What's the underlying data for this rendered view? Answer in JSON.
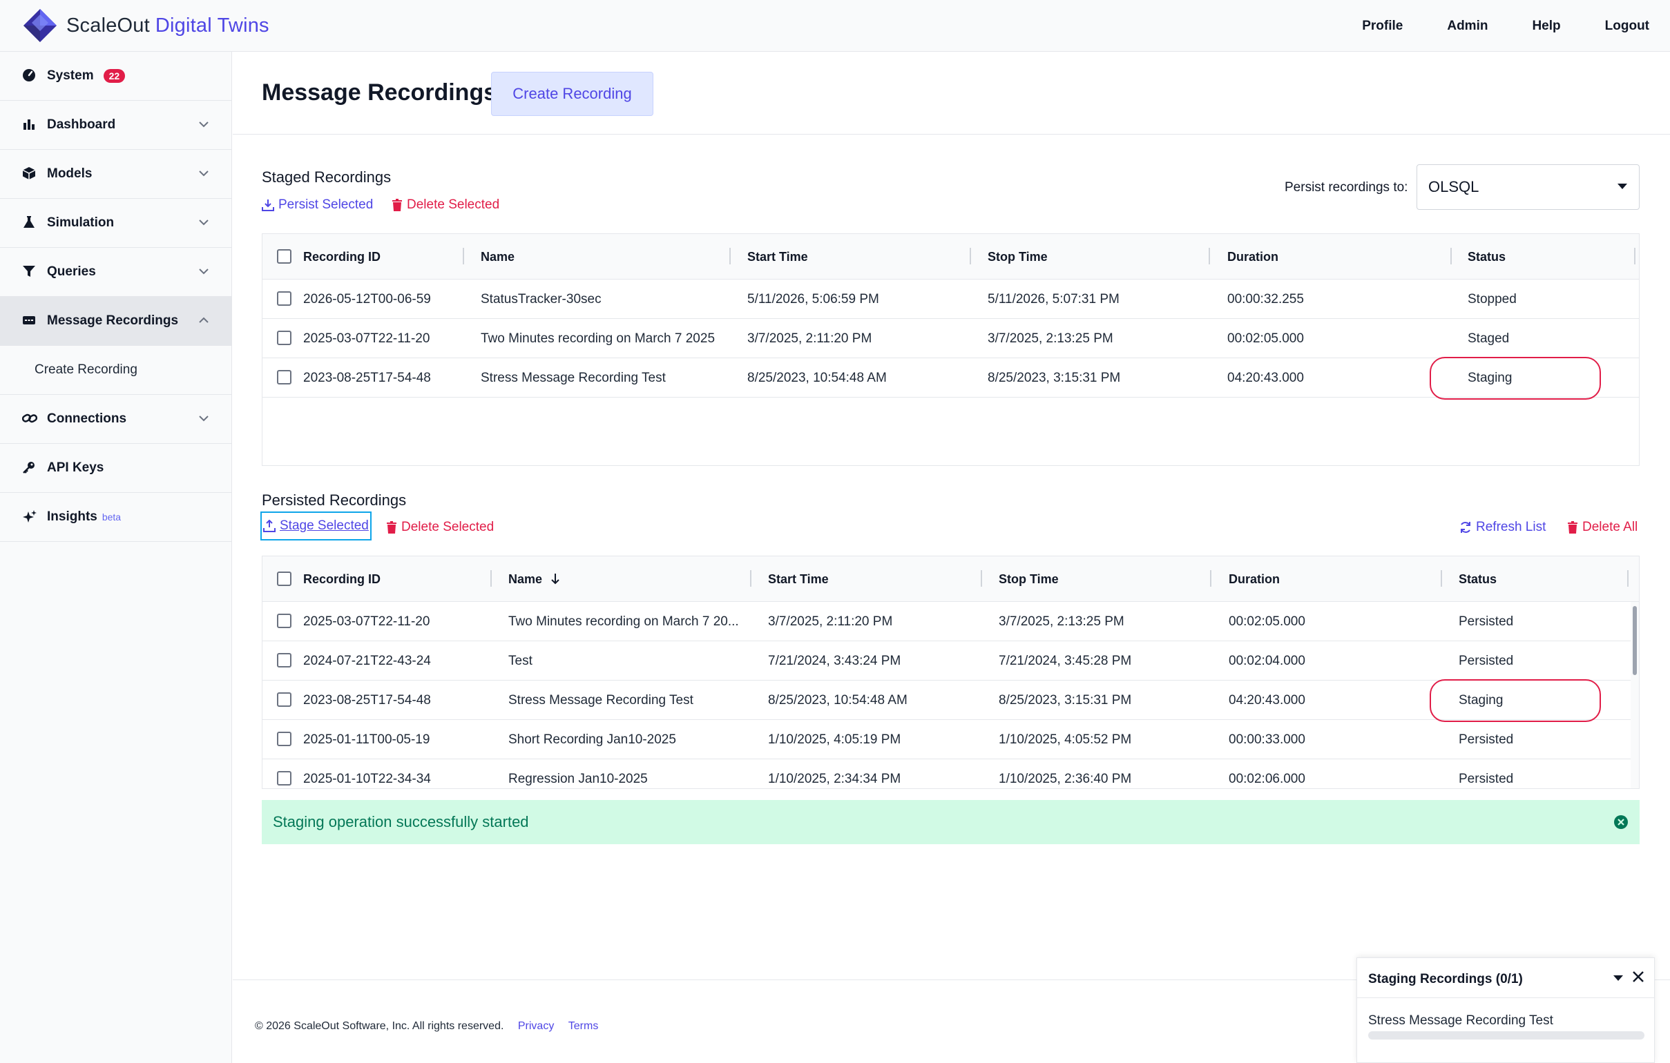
{
  "brand": {
    "name": "ScaleOut",
    "accent": "Digital Twins"
  },
  "topnav": {
    "profile": "Profile",
    "admin": "Admin",
    "help": "Help",
    "logout": "Logout"
  },
  "sidebar": {
    "items": [
      {
        "label": "System",
        "icon": "gauge-icon",
        "badge": "22"
      },
      {
        "label": "Dashboard",
        "icon": "bar-chart-icon"
      },
      {
        "label": "Models",
        "icon": "cube-icon"
      },
      {
        "label": "Simulation",
        "icon": "flask-icon"
      },
      {
        "label": "Queries",
        "icon": "filter-icon"
      },
      {
        "label": "Message Recordings",
        "icon": "message-icon"
      },
      {
        "label": "Connections",
        "icon": "link-icon"
      },
      {
        "label": "API Keys",
        "icon": "key-icon"
      },
      {
        "label": "Insights",
        "icon": "sparkles-icon",
        "beta": "beta"
      }
    ],
    "sub_create_recording": "Create Recording"
  },
  "page": {
    "title": "Message Recordings",
    "create_button": "Create Recording"
  },
  "staged": {
    "title": "Staged Recordings",
    "persist_selected": "Persist Selected",
    "delete_selected": "Delete Selected",
    "persist_to_label": "Persist recordings to:",
    "persist_to_value": "OLSQL",
    "columns": [
      "Recording ID",
      "Name",
      "Start Time",
      "Stop Time",
      "Duration",
      "Status"
    ],
    "rows": [
      [
        "2026-05-12T00-06-59",
        "StatusTracker-30sec",
        "5/11/2026, 5:06:59 PM",
        "5/11/2026, 5:07:31 PM",
        "00:00:32.255",
        "Stopped"
      ],
      [
        "2025-03-07T22-11-20",
        "Two Minutes recording on March 7 2025",
        "3/7/2025, 2:11:20 PM",
        "3/7/2025, 2:13:25 PM",
        "00:02:05.000",
        "Staged"
      ],
      [
        "2023-08-25T17-54-48",
        "Stress Message Recording Test",
        "8/25/2023, 10:54:48 AM",
        "8/25/2023, 3:15:31 PM",
        "04:20:43.000",
        "Staging"
      ]
    ]
  },
  "persisted": {
    "title": "Persisted Recordings",
    "stage_selected": "Stage Selected",
    "delete_selected": "Delete Selected",
    "refresh_list": "Refresh List",
    "delete_all": "Delete All",
    "columns": [
      "Recording ID",
      "Name",
      "Start Time",
      "Stop Time",
      "Duration",
      "Status"
    ],
    "rows": [
      [
        "2025-03-07T22-11-20",
        "Two Minutes recording on March 7 20...",
        "3/7/2025, 2:11:20 PM",
        "3/7/2025, 2:13:25 PM",
        "00:02:05.000",
        "Persisted"
      ],
      [
        "2024-07-21T22-43-24",
        "Test",
        "7/21/2024, 3:43:24 PM",
        "7/21/2024, 3:45:28 PM",
        "00:02:04.000",
        "Persisted"
      ],
      [
        "2023-08-25T17-54-48",
        "Stress Message Recording Test",
        "8/25/2023, 10:54:48 AM",
        "8/25/2023, 3:15:31 PM",
        "04:20:43.000",
        "Staging"
      ],
      [
        "2025-01-11T00-05-19",
        "Short Recording Jan10-2025",
        "1/10/2025, 4:05:19 PM",
        "1/10/2025, 4:05:52 PM",
        "00:00:33.000",
        "Persisted"
      ],
      [
        "2025-01-10T22-34-34",
        "Regression Jan10-2025",
        "1/10/2025, 2:34:34 PM",
        "1/10/2025, 2:36:40 PM",
        "00:02:06.000",
        "Persisted"
      ]
    ]
  },
  "toast": {
    "message": "Staging operation successfully started"
  },
  "footer": {
    "copyright": "© 2026 ScaleOut Software, Inc. All rights reserved.",
    "privacy": "Privacy",
    "terms": "Terms"
  },
  "panel": {
    "title": "Staging Recordings (0/1)",
    "item": "Stress Message Recording Test"
  },
  "colors": {
    "accent": "#4f46e5",
    "danger": "#e11d48",
    "success_bg": "#d1fae5",
    "success_text": "#047857"
  }
}
